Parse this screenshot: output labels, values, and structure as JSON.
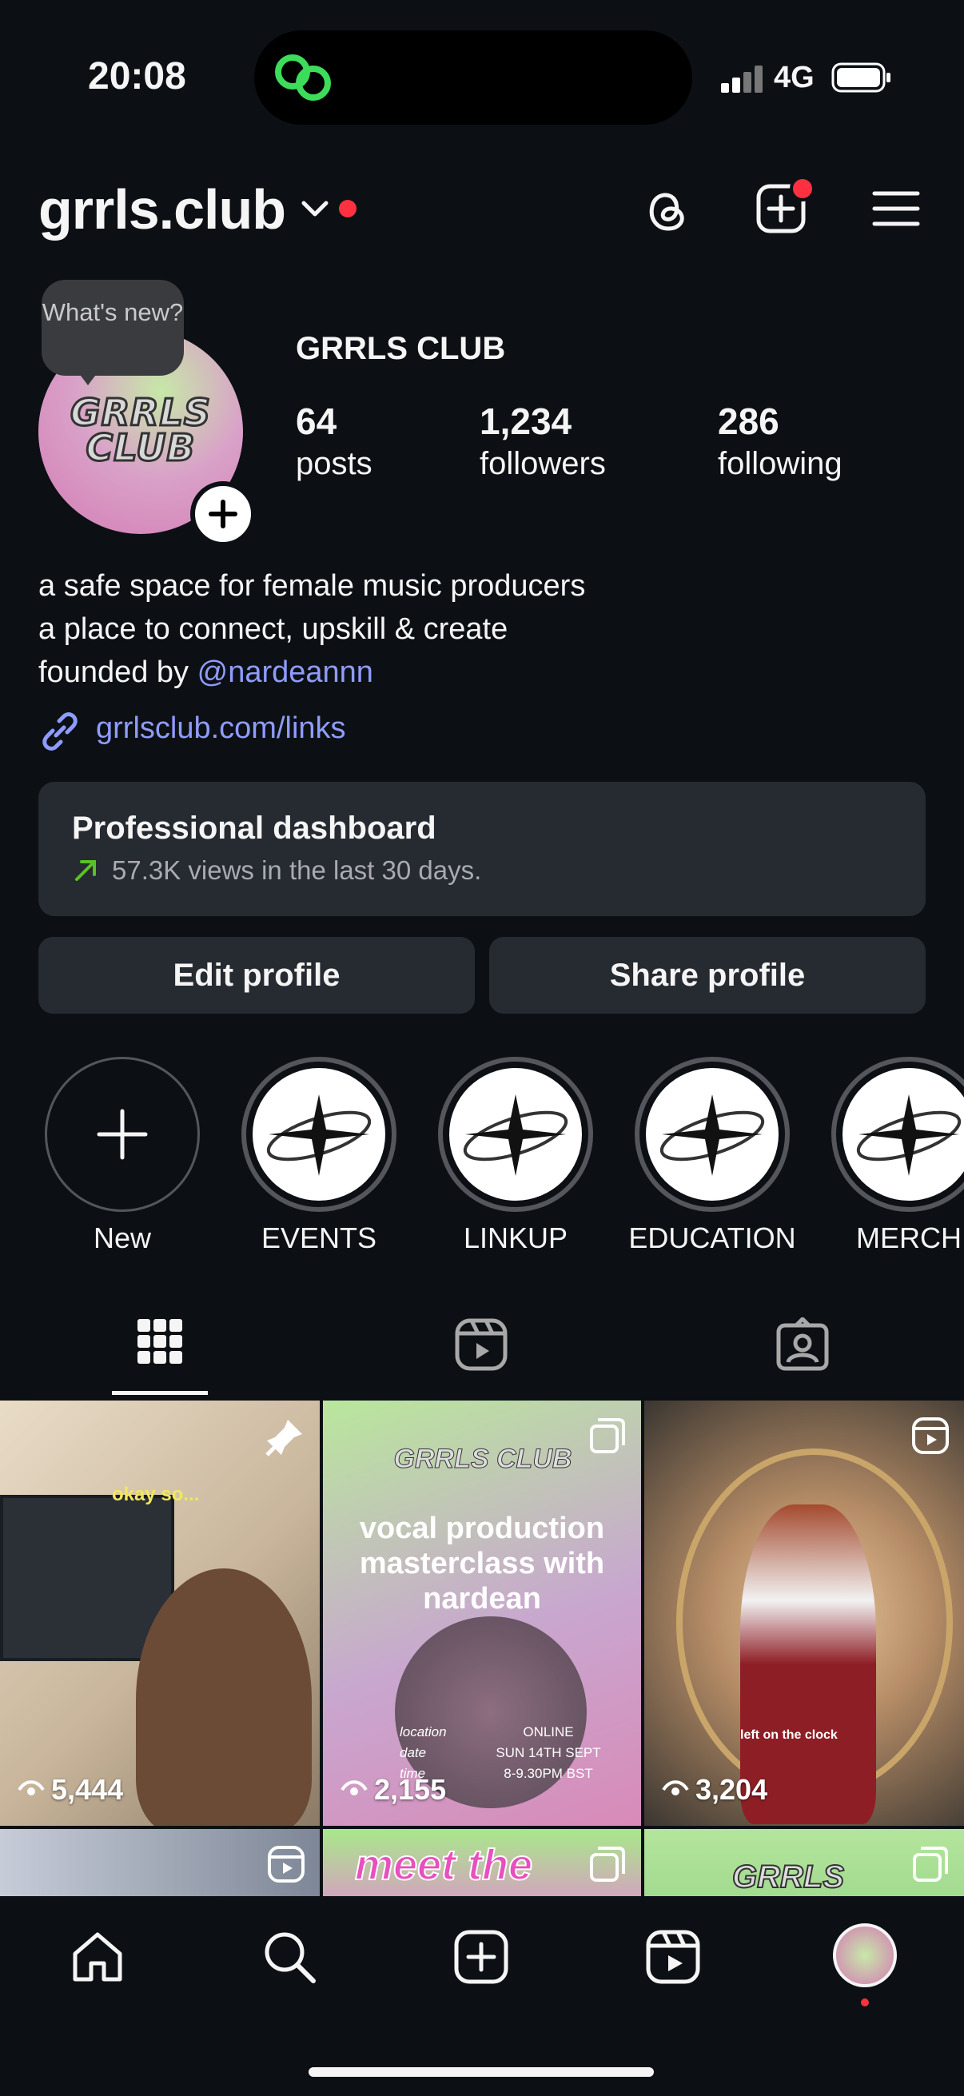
{
  "status": {
    "time": "20:08",
    "network": "4G"
  },
  "header": {
    "handle": "grrls.club"
  },
  "profile": {
    "bubble": "What's new?",
    "avatar_logo": "GRRLS CLUB",
    "name": "GRRLS CLUB",
    "stats": [
      {
        "value": "64",
        "label": "posts"
      },
      {
        "value": "1,234",
        "label": "followers"
      },
      {
        "value": "286",
        "label": "following"
      }
    ],
    "bio": [
      "a safe space for female music producers",
      "a place to connect, upskill & create",
      "founded by"
    ],
    "mention": "@nardeannn",
    "link": "grrlsclub.com/links"
  },
  "dashboard": {
    "title": "Professional dashboard",
    "subtitle": "57.3K views in the last 30 days."
  },
  "buttons": {
    "edit": "Edit profile",
    "share": "Share profile"
  },
  "highlights": [
    {
      "label": "New"
    },
    {
      "label": "EVENTS"
    },
    {
      "label": "LINKUP"
    },
    {
      "label": "EDUCATION"
    },
    {
      "label": "MERCH"
    }
  ],
  "posts": [
    {
      "views": "5,444",
      "caption": "okay so..."
    },
    {
      "views": "2,155",
      "caption": "vocal production masterclass with nardean",
      "details": [
        "location",
        "ONLINE",
        "date",
        "SUN 14TH SEPT",
        "time",
        "8-9.30PM BST"
      ]
    },
    {
      "views": "3,204",
      "caption": "left on the clock"
    },
    {
      "caption": ""
    },
    {
      "caption": "meet the"
    },
    {
      "caption": "GRRLS"
    }
  ],
  "colors": {
    "background": "#0c1014",
    "accent_link": "#8f9cff",
    "notification": "#ff3040",
    "card": "#262a31"
  }
}
